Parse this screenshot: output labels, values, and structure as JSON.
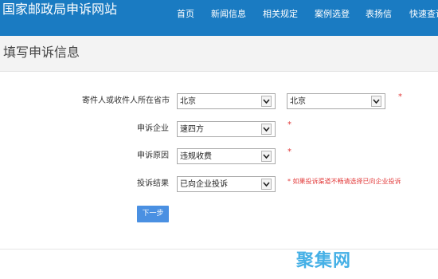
{
  "header": {
    "site_title": "国家邮政局申诉网站",
    "nav": [
      "首页",
      "新闻信息",
      "相关规定",
      "案例选登",
      "表扬信",
      "快速查询"
    ]
  },
  "page_title": "填写申诉信息",
  "form": {
    "location": {
      "label": "寄件人或收件人所在省市",
      "province": "北京",
      "city": "北京",
      "required_mark": "*"
    },
    "company": {
      "label": "申诉企业",
      "value": "速四方",
      "required_mark": "*"
    },
    "reason": {
      "label": "申诉原因",
      "value": "违规收费",
      "required_mark": "*"
    },
    "result": {
      "label": "投诉结果",
      "value": "已向企业投诉",
      "hint": "* 如果投诉渠道不畅请选择已向企业投诉"
    },
    "next_button": "下一步"
  },
  "watermark": "聚集网",
  "colors": {
    "header_bg": "#1a7bc2",
    "button_bg": "#4a90e2",
    "required": "#e23b3b",
    "watermark": "#45b0e6"
  }
}
